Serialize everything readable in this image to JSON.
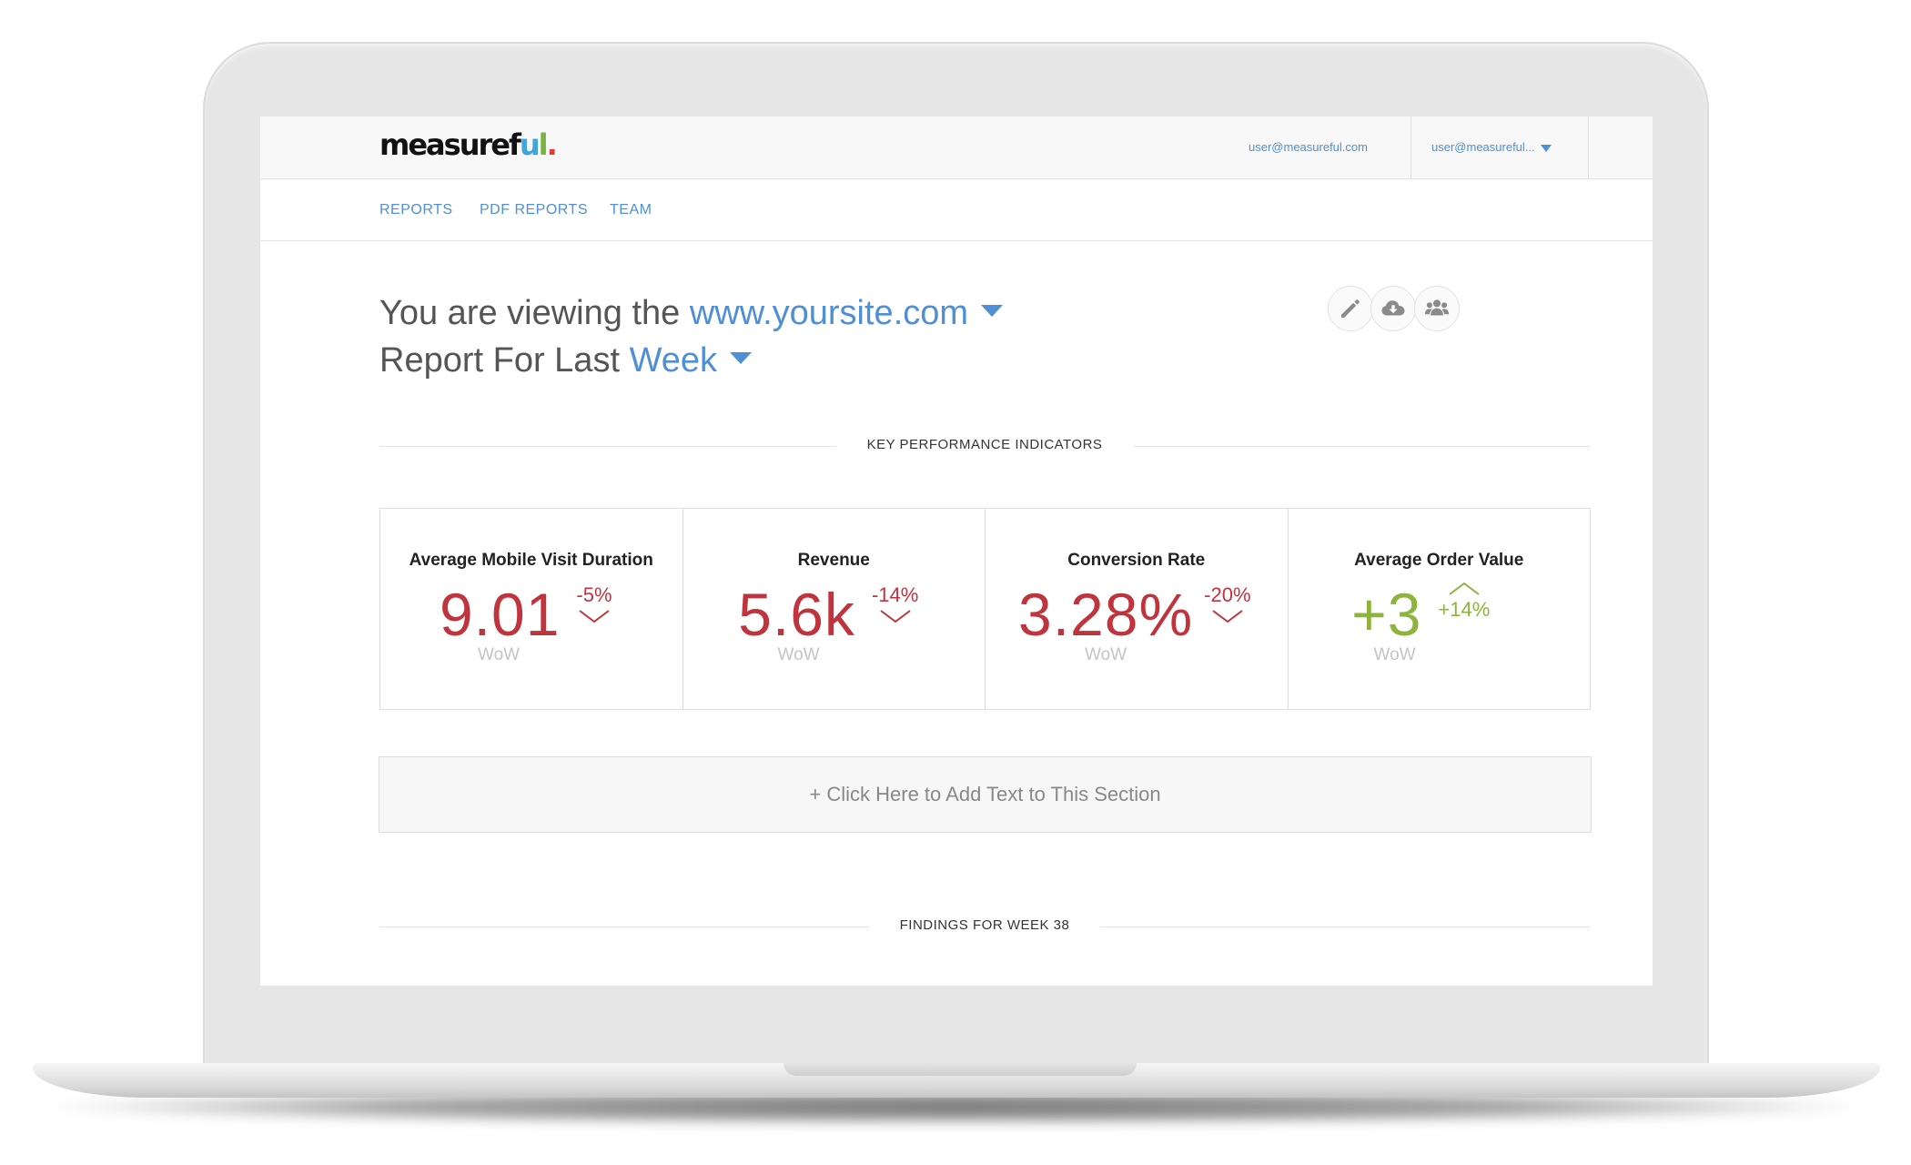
{
  "brand": {
    "logo_part1": "measuref",
    "logo_u": "u",
    "logo_l": "l",
    "logo_dot": ".",
    "colors": {
      "u": "#3fa6dd",
      "l": "#77b340",
      "dot": "#e03c31"
    }
  },
  "topbar": {
    "email": "user@measureful.com",
    "account_label": "user@measureful..."
  },
  "nav": {
    "items": [
      {
        "label": "REPORTS"
      },
      {
        "label": "PDF REPORTS"
      },
      {
        "label": "TEAM"
      }
    ]
  },
  "heading": {
    "line1_prefix": "You are viewing the",
    "site": "www.yoursite.com",
    "line2_prefix": "Report For Last",
    "period": "Week"
  },
  "toolbar": {
    "icons": [
      "pencil-icon",
      "cloud-download-icon",
      "team-icon"
    ]
  },
  "sections": {
    "kpi_label": "KEY PERFORMANCE INDICATORS",
    "findings_label": "FINDINGS FOR WEEK 38"
  },
  "kpis": [
    {
      "title": "Average Mobile Visit Duration",
      "value": "9.01",
      "change": "-5%",
      "direction": "down",
      "period": "WoW",
      "color": "#c0343e"
    },
    {
      "title": "Revenue",
      "value": "5.6k",
      "change": "-14%",
      "direction": "down",
      "period": "WoW",
      "color": "#c0343e"
    },
    {
      "title": "Conversion Rate",
      "value": "3.28%",
      "change": "-20%",
      "direction": "down",
      "period": "WoW",
      "color": "#c0343e"
    },
    {
      "title": "Average Order Value",
      "value": "+3",
      "change": "+14%",
      "direction": "up",
      "period": "WoW",
      "color": "#8db43c"
    }
  ],
  "add_text_label": "+ Click Here to Add Text to This Section"
}
